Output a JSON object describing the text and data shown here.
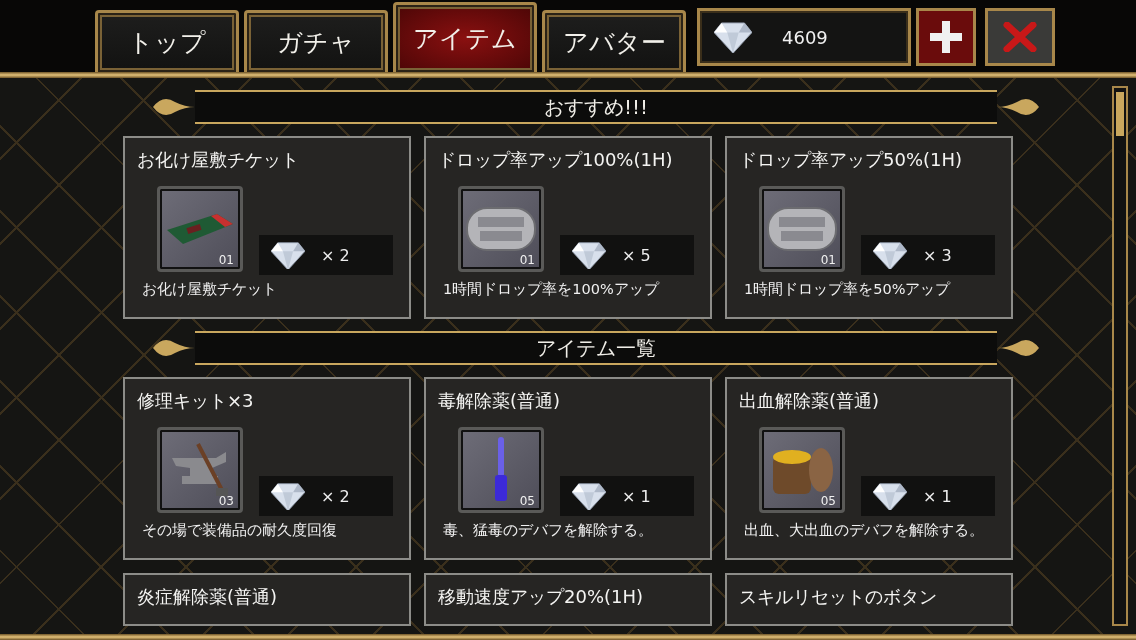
{
  "tabs": [
    {
      "label": "トップ",
      "selected": false
    },
    {
      "label": "ガチャ",
      "selected": false
    },
    {
      "label": "アイテム",
      "selected": true
    },
    {
      "label": "アバター",
      "selected": false
    }
  ],
  "currency": {
    "amount": "4609"
  },
  "sections": [
    {
      "title": "おすすめ!!!",
      "items": [
        {
          "name": "お化け屋敷チケット",
          "kind": "ticket",
          "count": "01",
          "price": "× 2",
          "description": "お化け屋敷チケット"
        },
        {
          "name": "ドロップ率アップ100%(1H)",
          "kind": "tag",
          "count": "01",
          "price": "× 5",
          "description": "1時間ドロップ率を100%アップ"
        },
        {
          "name": "ドロップ率アップ50%(1H)",
          "kind": "tag",
          "count": "01",
          "price": "× 3",
          "description": "1時間ドロップ率を50%アップ"
        }
      ]
    },
    {
      "title": "アイテム一覧",
      "items": [
        {
          "name": "修理キット×3",
          "kind": "anvil",
          "count": "03",
          "price": "× 2",
          "description": "その場で装備品の耐久度回復"
        },
        {
          "name": "毒解除薬(普通)",
          "kind": "vial",
          "count": "05",
          "price": "× 1",
          "description": "毒、猛毒のデバフを解除する。"
        },
        {
          "name": "出血解除薬(普通)",
          "kind": "jar",
          "count": "05",
          "price": "× 1",
          "description": "出血、大出血のデバフを解除する。"
        },
        {
          "name": "炎症解除薬(普通)"
        },
        {
          "name": "移動速度アップ20%(1H)"
        },
        {
          "name": "スキルリセットのボタン"
        }
      ]
    }
  ]
}
